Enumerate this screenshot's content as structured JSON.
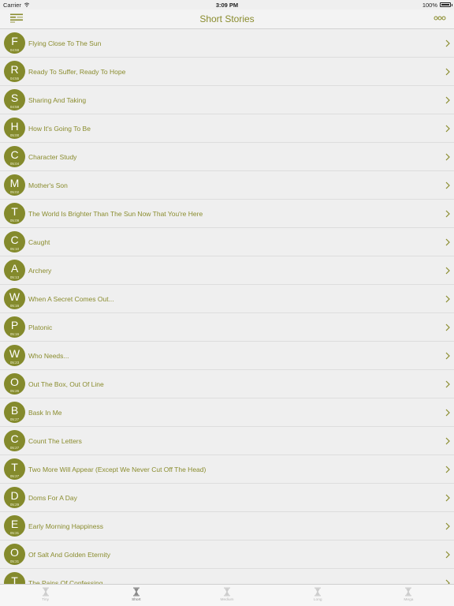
{
  "status_bar": {
    "carrier": "Carrier",
    "time": "3:09 PM",
    "battery": "100%",
    "battery_level": 1.0
  },
  "nav": {
    "title": "Short Stories",
    "menu_icon": "menu-icon",
    "more_icon": "more-icon"
  },
  "stories": [
    {
      "letter": "F",
      "duration": "04:59",
      "title": "Flying Close To The Sun"
    },
    {
      "letter": "R",
      "duration": "04:55",
      "title": "Ready To Suffer, Ready To Hope"
    },
    {
      "letter": "S",
      "duration": "04:58",
      "title": "Sharing And Taking"
    },
    {
      "letter": "H",
      "duration": "05:00",
      "title": "How It's Going To Be"
    },
    {
      "letter": "C",
      "duration": "05:04",
      "title": "Character Study"
    },
    {
      "letter": "M",
      "duration": "05:02",
      "title": "Mother's Son"
    },
    {
      "letter": "T",
      "duration": "05:09",
      "title": "The World Is Brighter Than The Sun Now That You're Here"
    },
    {
      "letter": "C",
      "duration": "05:10",
      "title": "Caught"
    },
    {
      "letter": "A",
      "duration": "05:13",
      "title": "Archery"
    },
    {
      "letter": "W",
      "duration": "05:16",
      "title": "When A Secret Comes Out..."
    },
    {
      "letter": "P",
      "duration": "05:16",
      "title": "Platonic"
    },
    {
      "letter": "W",
      "duration": "05:23",
      "title": "Who Needs..."
    },
    {
      "letter": "O",
      "duration": "05:26",
      "title": "Out The Box, Out Of Line"
    },
    {
      "letter": "B",
      "duration": "05:27",
      "title": "Bask In Me"
    },
    {
      "letter": "C",
      "duration": "05:27",
      "title": "Count The Letters"
    },
    {
      "letter": "T",
      "duration": "05:27",
      "title": "Two More Will Appear (Except We Never Cut Off The Head)"
    },
    {
      "letter": "D",
      "duration": "05:29",
      "title": "Doms For A Day"
    },
    {
      "letter": "E",
      "duration": "05:31",
      "title": "Early Morning Happiness"
    },
    {
      "letter": "O",
      "duration": "05:31",
      "title": "Of Salt And Golden Eternity"
    },
    {
      "letter": "T",
      "duration": "05:33",
      "title": "The Pains Of Confessing"
    }
  ],
  "tabs": [
    {
      "label": "Tiny",
      "icon": "hourglass-icon",
      "active": false
    },
    {
      "label": "Short",
      "icon": "hourglass-icon",
      "active": true
    },
    {
      "label": "Medium",
      "icon": "hourglass-icon",
      "active": false
    },
    {
      "label": "Long",
      "icon": "hourglass-icon",
      "active": false
    },
    {
      "label": "Mega",
      "icon": "hourglass-icon",
      "active": false
    }
  ],
  "colors": {
    "accent": "#8a8c2e",
    "avatar_bg": "#848a2c",
    "background": "#efefef"
  }
}
